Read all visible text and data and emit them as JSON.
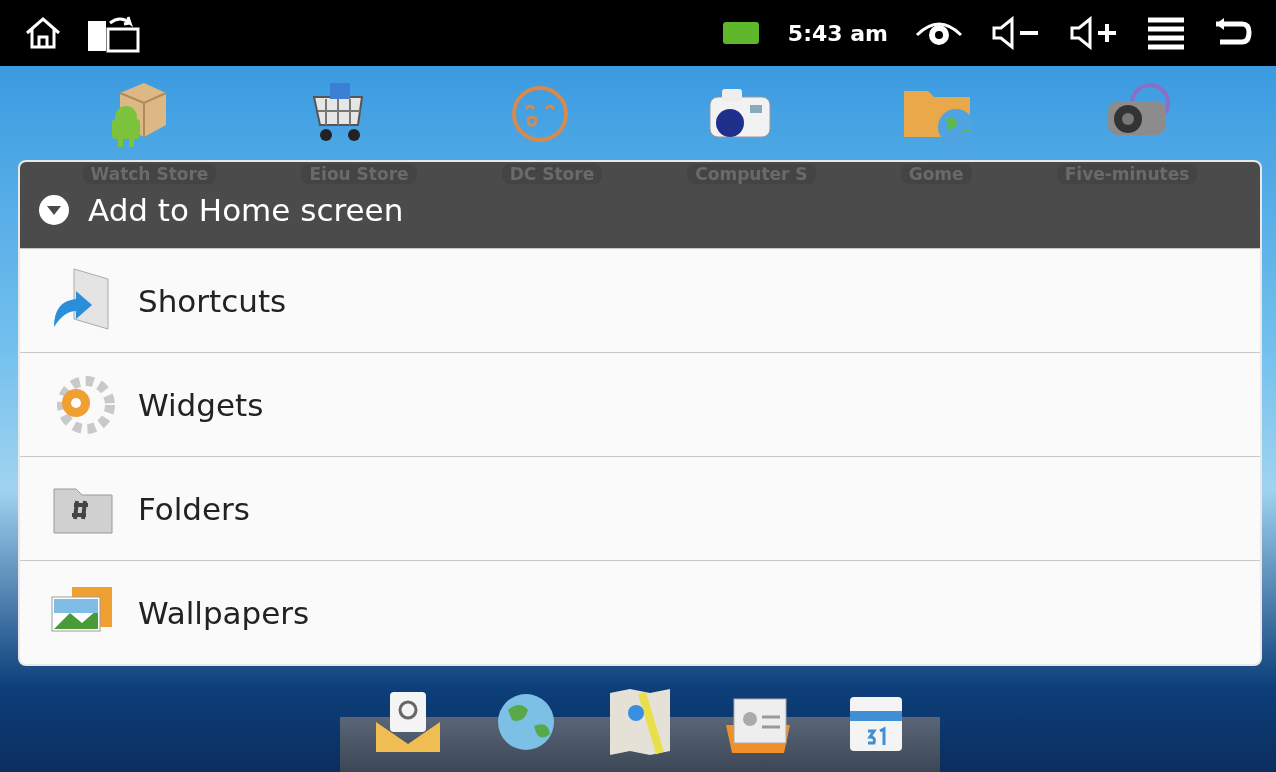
{
  "status_bar": {
    "time": "5:43 am"
  },
  "desktop_apps": [
    {
      "kind": "package",
      "label": "Watch Store"
    },
    {
      "kind": "cart",
      "label": "Eiou Store"
    },
    {
      "kind": "face",
      "label": "DC Store"
    },
    {
      "kind": "camera",
      "label": "Computer S"
    },
    {
      "kind": "folder",
      "label": "Gome"
    },
    {
      "kind": "video",
      "label": "Five-minutes"
    }
  ],
  "dialog": {
    "title": "Add to Home screen",
    "items": [
      {
        "kind": "shortcuts",
        "label": "Shortcuts"
      },
      {
        "kind": "widgets",
        "label": "Widgets"
      },
      {
        "kind": "folders",
        "label": "Folders"
      },
      {
        "kind": "wallpapers",
        "label": "Wallpapers"
      }
    ]
  }
}
